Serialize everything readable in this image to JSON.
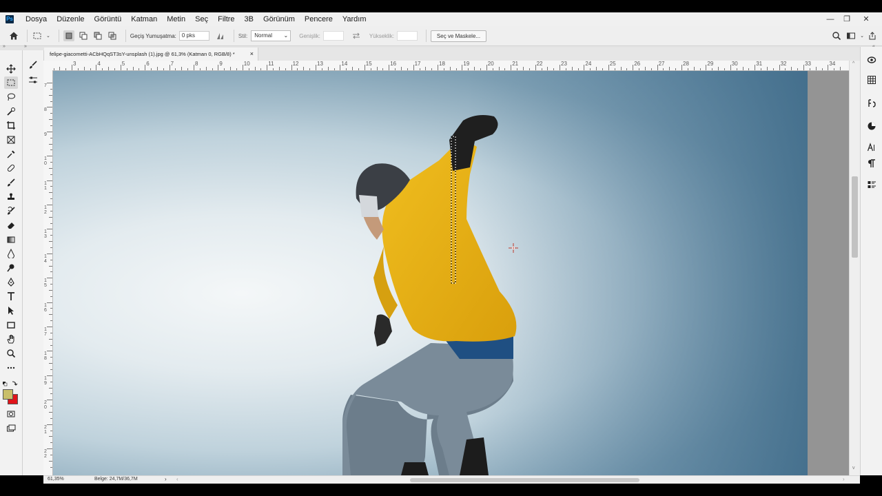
{
  "app": {
    "logo_text": "Ps"
  },
  "menu": [
    "Dosya",
    "Düzenle",
    "Görüntü",
    "Katman",
    "Metin",
    "Seç",
    "Filtre",
    "3B",
    "Görünüm",
    "Pencere",
    "Yardım"
  ],
  "window_controls": {
    "minimize": "—",
    "restore": "❐",
    "close": "✕"
  },
  "options_bar": {
    "feather_label": "Geçiş Yumuşatma:",
    "feather_value": "0 pks",
    "style_label": "Stil:",
    "style_value": "Normal",
    "width_label": "Genişlik:",
    "height_label": "Yükseklik:",
    "select_mask_button": "Seç ve Maskele..."
  },
  "document": {
    "tab_title": "felipe-giacometti-ACbHQqST3sY-unsplash (1).jpg @ 61,3% (Katman 0, RGB/8) *",
    "close": "×"
  },
  "ruler": {
    "top_labels": [
      "3",
      "4",
      "5",
      "6",
      "7",
      "8",
      "9",
      "10",
      "11",
      "12",
      "13",
      "14",
      "15",
      "16",
      "17",
      "18",
      "19",
      "20",
      "21",
      "22",
      "23",
      "24",
      "25",
      "26",
      "27",
      "28",
      "29",
      "30",
      "31",
      "32",
      "33",
      "34"
    ],
    "left_labels": [
      "7",
      "8",
      "9",
      "10",
      "11",
      "12",
      "13",
      "14",
      "15",
      "16",
      "17",
      "18",
      "19",
      "20",
      "21",
      "22"
    ]
  },
  "status": {
    "zoom": "61,35%",
    "doc_size": "Belge: 24,7M/36,7M"
  },
  "colors": {
    "foreground": "#c9bf6a",
    "background": "#e0141a",
    "accent": "#31a8ff"
  },
  "tools": [
    "move-icon",
    "marquee-icon",
    "lasso-icon",
    "quick-select-icon",
    "crop-icon",
    "frame-icon",
    "eyedropper-icon",
    "healing-icon",
    "brush-icon",
    "stamp-icon",
    "history-brush-icon",
    "eraser-icon",
    "gradient-icon",
    "blur-icon",
    "dodge-icon",
    "pen-icon",
    "type-icon",
    "path-select-icon",
    "shape-icon",
    "hand-icon",
    "zoom-icon",
    "more-icon"
  ],
  "right_panel_icons": [
    "3d-icon",
    "grid-icon",
    "adjustments-icon",
    "color-icon",
    "character-icon",
    "paragraph-icon",
    "properties-icon"
  ]
}
